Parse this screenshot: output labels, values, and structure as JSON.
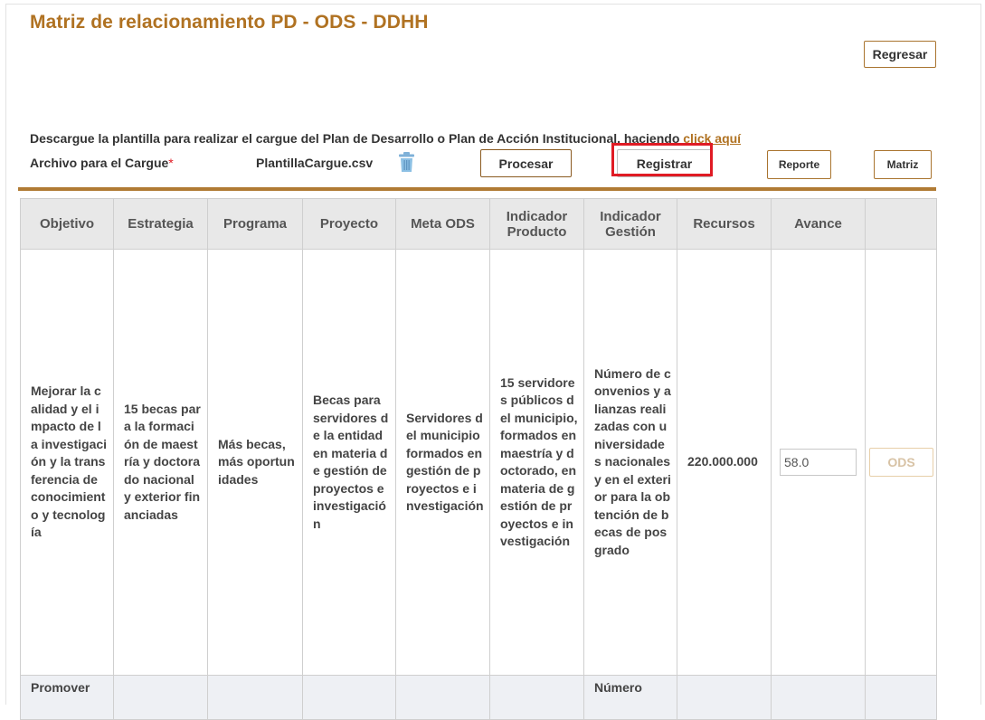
{
  "page": {
    "title": "Matriz de relacionamiento PD - ODS - DDHH",
    "back_button": "Regresar"
  },
  "upload": {
    "instruction": "Descargue la plantilla para realizar el cargue del Plan de Desarrollo o Plan de Acción Institucional, haciendo ",
    "link_text": "click aquí",
    "file_label": "Archivo para el Cargue",
    "required_mark": "*",
    "file_name": "PlantillaCargue.csv",
    "trash_icon": "trash-icon",
    "process_button": "Procesar",
    "register_button": "Registrar",
    "report_button": "Reporte",
    "matrix_button": "Matriz"
  },
  "colors": {
    "accent": "#b07222",
    "highlight": "#e01b24",
    "rule": "#b07b34"
  },
  "table": {
    "columns": [
      "Objetivo",
      "Estrategia",
      "Programa",
      "Proyecto",
      "Meta ODS",
      "Indicador Producto",
      "Indicador Gestión",
      "Recursos",
      "Avance",
      ""
    ],
    "rows": [
      {
        "objetivo": "Mejorar la calidad y el impacto de la investigación y la transferencia de conocimiento y tecnología",
        "estrategia": "15 becas para la formación de maestría y doctorado nacional y exterior financiadas",
        "programa": "Más becas, más oportunidades",
        "proyecto": "Becas para servidores de la entidad en materia de gestión de proyectos e investigación",
        "meta_ods": "Servidores del municipio formados en gestión de proyectos e investigación",
        "indicador_producto": "15 servidores públicos del municipio, formados en maestría y doctorado, en materia de gestión de proyectos e investigación",
        "indicador_gestion": "Número de convenios y alianzas realizadas con universidades nacionales y en el exterior para la obtención de becas de posgrado",
        "recursos": "220.000.000",
        "avance": "58.0",
        "action": "ODS"
      },
      {
        "objetivo": "Promover",
        "indicador_gestion": "Número"
      }
    ]
  }
}
